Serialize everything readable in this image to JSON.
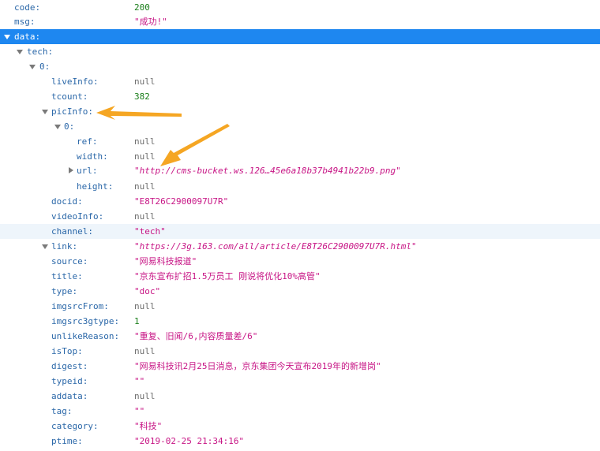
{
  "rows": {
    "code": {
      "key": "code:",
      "value": "200"
    },
    "msg": {
      "key": "msg:",
      "value": "\"成功!\""
    },
    "data": {
      "key": "data:"
    },
    "tech": {
      "key": "tech:"
    },
    "item0": {
      "key": "0:"
    },
    "liveInfo": {
      "key": "liveInfo:",
      "value": "null"
    },
    "tcount": {
      "key": "tcount:",
      "value": "382"
    },
    "picInfo": {
      "key": "picInfo:"
    },
    "pic0": {
      "key": "0:"
    },
    "ref": {
      "key": "ref:",
      "value": "null"
    },
    "width": {
      "key": "width:",
      "value": "null"
    },
    "url": {
      "key": "url:",
      "value": "\"http://cms-bucket.ws.126…45e6a18b37b4941b22b9.png\""
    },
    "height": {
      "key": "height:",
      "value": "null"
    },
    "docid": {
      "key": "docid:",
      "value": "\"E8T26C2900097U7R\""
    },
    "videoInfo": {
      "key": "videoInfo:",
      "value": "null"
    },
    "channel": {
      "key": "channel:",
      "value": "\"tech\""
    },
    "link": {
      "key": "link:",
      "value": "\"https://3g.163.com/all/article/E8T26C2900097U7R.html\""
    },
    "source": {
      "key": "source:",
      "value": "\"网易科技报道\""
    },
    "title": {
      "key": "title:",
      "value": "\"京东宣布扩招1.5万员工 刚说将优化10%高管\""
    },
    "type": {
      "key": "type:",
      "value": "\"doc\""
    },
    "imgsrcFrom": {
      "key": "imgsrcFrom:",
      "value": "null"
    },
    "imgsrc3gtype": {
      "key": "imgsrc3gtype:",
      "value": "1"
    },
    "unlikeReason": {
      "key": "unlikeReason:",
      "value": "\"重复、旧闻/6,内容质量差/6\""
    },
    "isTop": {
      "key": "isTop:",
      "value": "null"
    },
    "digest": {
      "key": "digest:",
      "value": "\"网易科技讯2月25日消息，京东集团今天宣布2019年的新增岗\""
    },
    "typeid": {
      "key": "typeid:",
      "value": "\"\""
    },
    "addata": {
      "key": "addata:",
      "value": "null"
    },
    "tag": {
      "key": "tag:",
      "value": "\"\""
    },
    "category": {
      "key": "category:",
      "value": "\"科技\""
    },
    "ptime": {
      "key": "ptime:",
      "value": "\"2019-02-25 21:34:16\""
    }
  },
  "colors": {
    "selected": "#1e87f0",
    "key": "#2a67a8",
    "number": "#1a7e1a",
    "string": "#c71585",
    "null": "#6d6d6d",
    "annotation_arrow": "#f5a623"
  },
  "icons": {
    "expanded": "triangle-down-icon",
    "collapsed": "triangle-right-icon",
    "annotation": "arrow-annotation-icon"
  }
}
